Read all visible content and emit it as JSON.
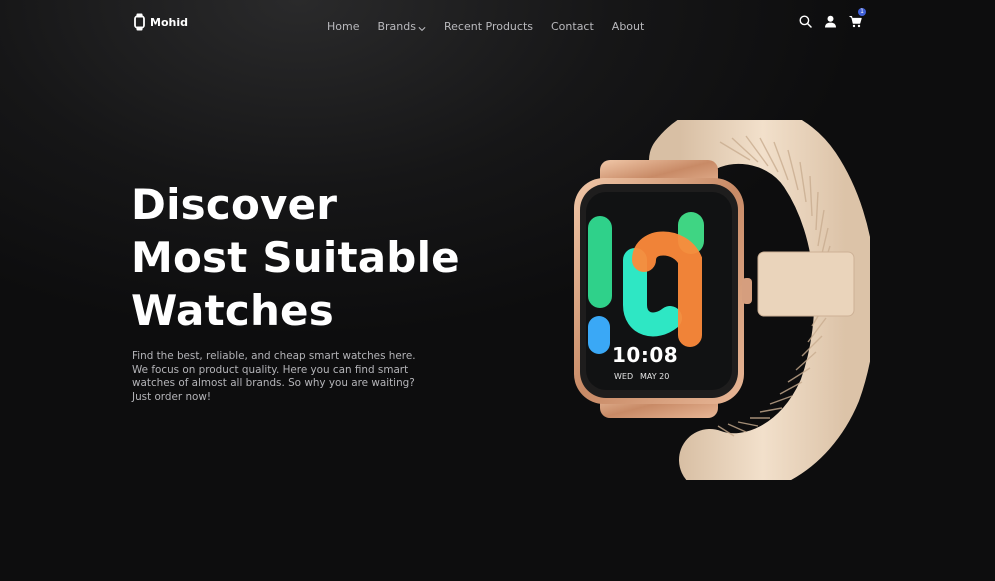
{
  "brand": {
    "name": "Mohid",
    "logo_icon": "watch-icon"
  },
  "nav": {
    "links": [
      {
        "label": "Home"
      },
      {
        "label": "Brands",
        "icon": "chevron-down-icon"
      },
      {
        "label": "Recent Products"
      },
      {
        "label": "Contact"
      },
      {
        "label": "About"
      }
    ],
    "icons": [
      "search-icon",
      "user-icon",
      "cart-icon"
    ],
    "cart_count": "1"
  },
  "hero": {
    "title_lines": [
      "Discover",
      "Most Suitable",
      "Watches"
    ],
    "description": "Find the best, reliable, and cheap smart watches here. We focus on product quality. Here you can find smart watches of almost all brands. So why you are waiting? Just order now!"
  },
  "watch_display": {
    "time": "10:08",
    "day": "WED",
    "date": "MAY 20"
  },
  "colors": {
    "background": "#0e0e0f",
    "nav_text": "#b9b9bd",
    "body_text": "#b4b4b8",
    "badge": "#3f5fd6",
    "strap": "#eed9c0",
    "case": "#d9a98a"
  }
}
